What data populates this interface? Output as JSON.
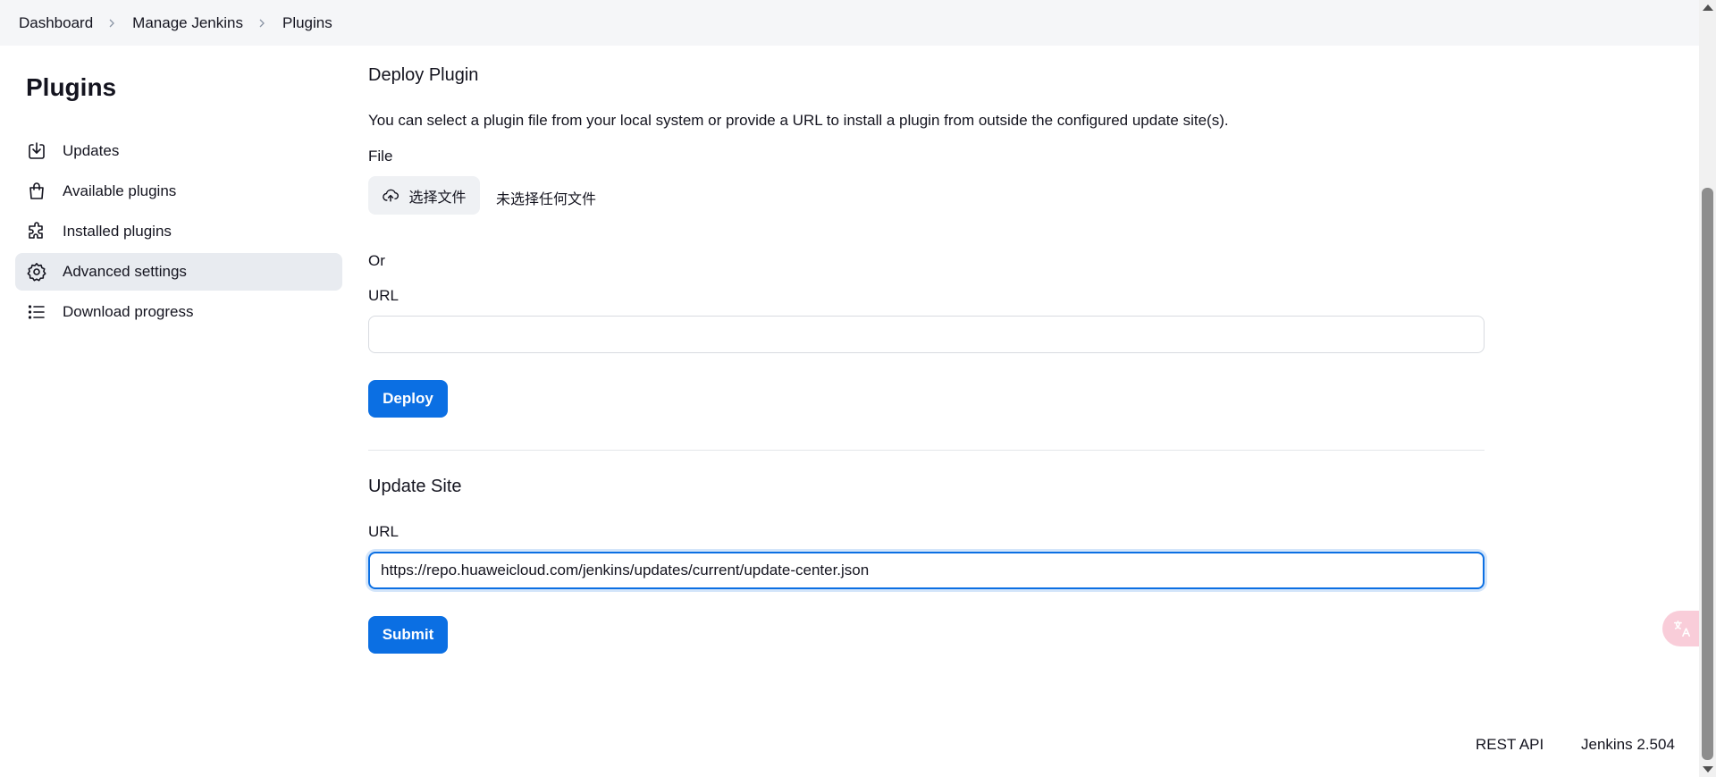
{
  "breadcrumb": {
    "items": [
      "Dashboard",
      "Manage Jenkins",
      "Plugins"
    ]
  },
  "sidebar": {
    "title": "Plugins",
    "items": [
      {
        "label": "Updates",
        "icon": "download-icon"
      },
      {
        "label": "Available plugins",
        "icon": "shopping-bag-icon"
      },
      {
        "label": "Installed plugins",
        "icon": "puzzle-icon"
      },
      {
        "label": "Advanced settings",
        "icon": "gear-icon",
        "active": true
      },
      {
        "label": "Download progress",
        "icon": "list-icon"
      }
    ]
  },
  "deploy": {
    "title": "Deploy Plugin",
    "description": "You can select a plugin file from your local system or provide a URL to install a plugin from outside the configured update site(s).",
    "file_label": "File",
    "choose_file": "选择文件",
    "no_file": "未选择任何文件",
    "or_label": "Or",
    "url_label": "URL",
    "url_value": "",
    "button": "Deploy"
  },
  "update_site": {
    "title": "Update Site",
    "url_label": "URL",
    "url_value": "https://repo.huaweicloud.com/jenkins/updates/current/update-center.json",
    "button": "Submit"
  },
  "footer": {
    "rest_api": "REST API",
    "version": "Jenkins 2.504"
  },
  "colors": {
    "accent": "#0b6fe3",
    "sidebar_active": "#e8ebf0",
    "breadcrumb_bg": "#f5f6f8"
  }
}
